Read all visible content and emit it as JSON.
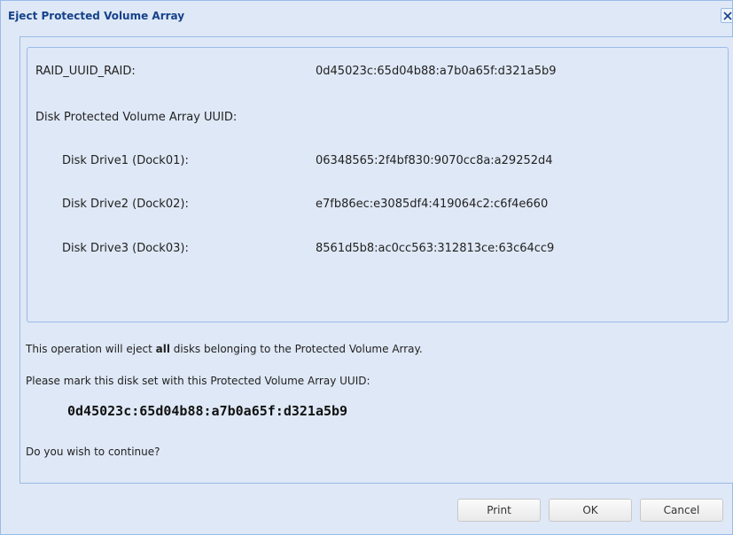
{
  "dialog": {
    "title": "Eject Protected Volume Array",
    "close_glyph": "✕"
  },
  "info": {
    "raid_uuid_label": "RAID_UUID_RAID:",
    "raid_uuid_value": "0d45023c:65d04b88:a7b0a65f:d321a5b9",
    "disk_array_uuid_label": "Disk Protected Volume Array UUID:",
    "drives": [
      {
        "label": "Disk Drive1 (Dock01):",
        "value": "06348565:2f4bf830:9070cc8a:a29252d4"
      },
      {
        "label": "Disk Drive2 (Dock02):",
        "value": "e7fb86ec:e3085df4:419064c2:c6f4e660"
      },
      {
        "label": "Disk Drive3 (Dock03):",
        "value": "8561d5b8:ac0cc563:312813ce:63c64cc9"
      }
    ]
  },
  "message": {
    "line1_prefix": "This operation will eject ",
    "line1_bold": "all",
    "line1_suffix": " disks belonging to the Protected Volume Array.",
    "line2": "Please mark this disk set with this Protected Volume Array UUID:",
    "uuid": "0d45023c:65d04b88:a7b0a65f:d321a5b9",
    "question": "Do you wish to continue?"
  },
  "buttons": {
    "print": "Print",
    "ok": "OK",
    "cancel": "Cancel"
  },
  "colors": {
    "background": "#dfe8f6",
    "border": "#99bbe8",
    "title_text": "#15428b"
  },
  "icons": {
    "close": "close-icon"
  }
}
